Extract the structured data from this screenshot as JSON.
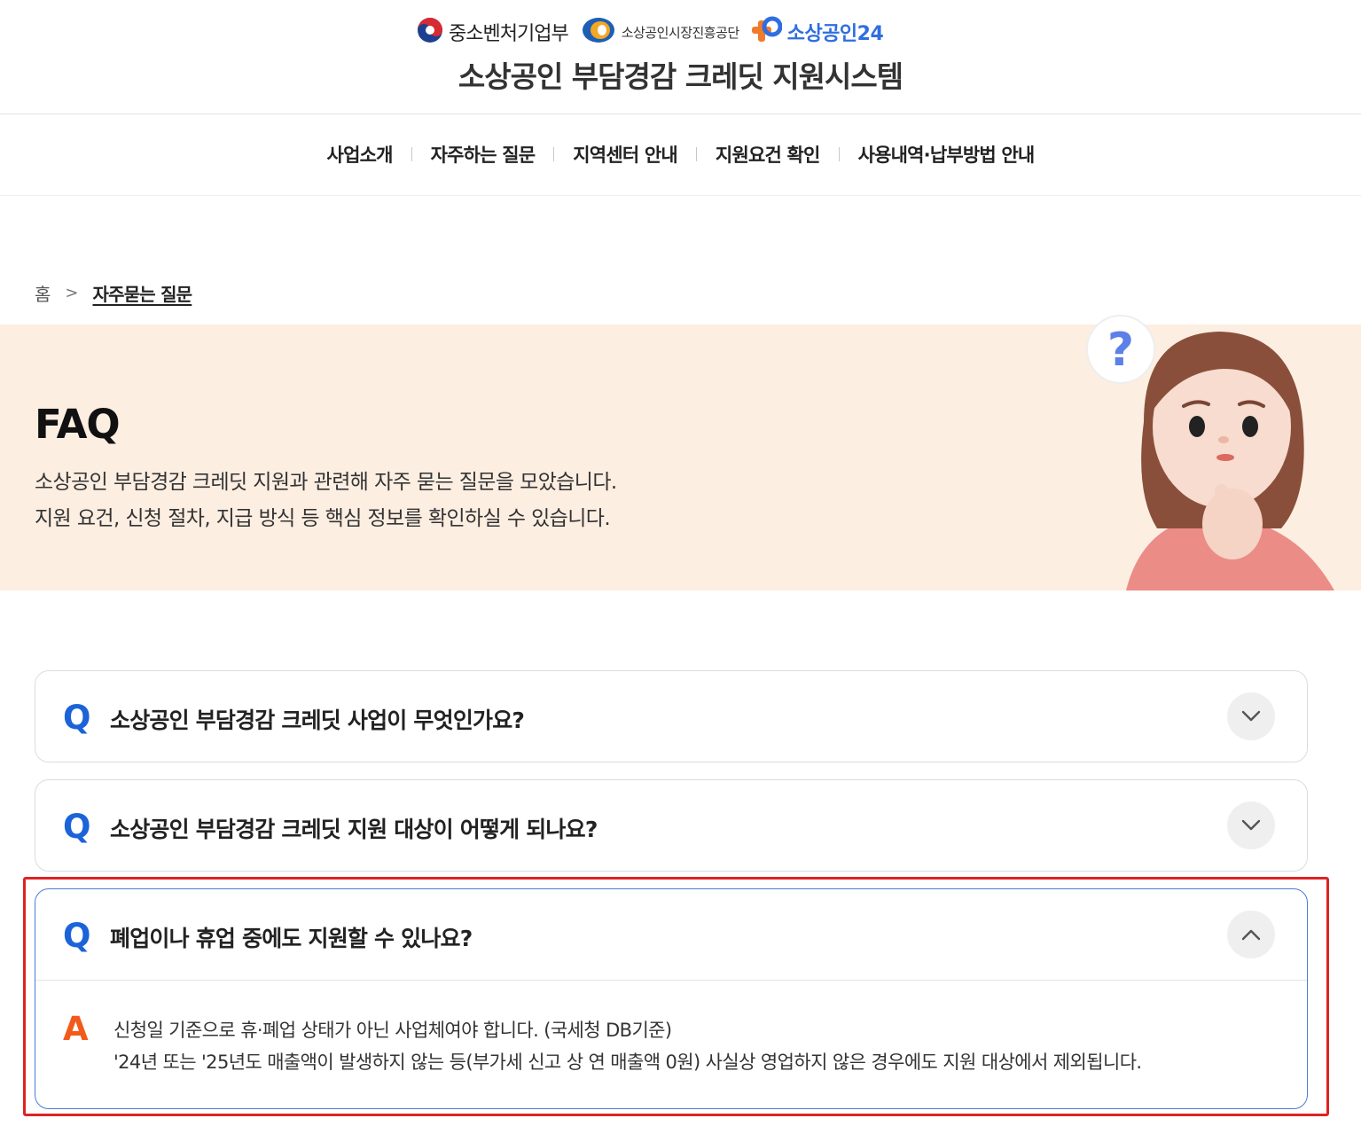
{
  "header": {
    "logos": {
      "mss": "중소벤처기업부",
      "semas": "소상공인시장진흥공단",
      "sbiz": "소상공인24"
    },
    "title": "소상공인 부담경감 크레딧 지원시스템"
  },
  "nav": {
    "items": [
      "사업소개",
      "자주하는 질문",
      "지역센터 안내",
      "지원요건 확인",
      "사용내역·납부방법 안내"
    ]
  },
  "breadcrumb": {
    "home": "홈",
    "separator": ">",
    "current": "자주묻는 질문"
  },
  "hero": {
    "title": "FAQ",
    "desc_line1": "소상공인 부담경감 크레딧 지원과 관련해 자주 묻는 질문을 모았습니다.",
    "desc_line2": "지원 요건, 신청 절차, 지급 방식 등 핵심 정보를 확인하실 수 있습니다."
  },
  "faq": {
    "q_label": "Q",
    "a_label": "A",
    "items": [
      {
        "question": "소상공인 부담경감 크레딧 사업이 무엇인가요?",
        "expanded": false
      },
      {
        "question": "소상공인 부담경감 크레딧 지원 대상이 어떻게 되나요?",
        "expanded": false
      },
      {
        "question": "폐업이나 휴업 중에도 지원할 수 있나요?",
        "expanded": true,
        "answer_line1": "신청일 기준으로 휴·폐업 상태가 아닌 사업체여야 합니다. (국세청 DB기준)",
        "answer_line2": "'24년 또는 '25년도 매출액이 발생하지 않는 등(부가세 신고 상 연 매출액 0원) 사실상 영업하지 않은 경우에도 지원 대상에서 제외됩니다."
      }
    ]
  },
  "colors": {
    "q_accent": "#1b63d8",
    "a_accent": "#f25a1b",
    "hero_bg": "#fdeee2",
    "highlight": "#e02222"
  },
  "icons": [
    "taegeuk-logo-icon",
    "semas-logo-icon",
    "sbiz-plus-logo-icon",
    "chevron-down-icon",
    "chevron-up-icon",
    "thinking-woman-illustration"
  ]
}
